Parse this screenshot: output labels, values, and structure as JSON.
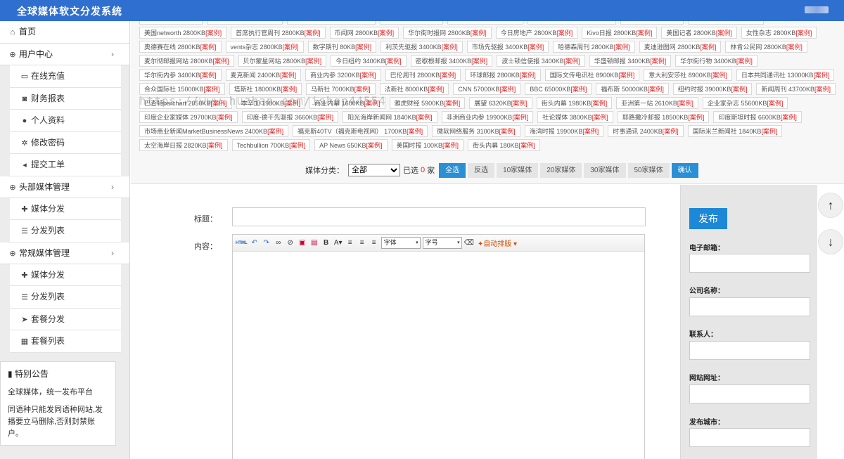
{
  "header": {
    "title": "全球媒体软文分发系统"
  },
  "sidebar": {
    "home": "首页",
    "groups": [
      {
        "label": "用户中心",
        "items": [
          "在线充值",
          "财务报表",
          "个人资料",
          "修改密码",
          "提交工单"
        ]
      },
      {
        "label": "头部媒体管理",
        "items": [
          "媒体分发",
          "分发列表"
        ]
      },
      {
        "label": "常规媒体管理",
        "items": [
          "媒体分发",
          "分发列表",
          "套餐分发",
          "套餐列表"
        ]
      }
    ],
    "notice": {
      "title": "特别公告",
      "line1": "全球媒体，统一发布平台",
      "line2": "同语种只能发同语种网站,发播要立马删除,否则封禁账户。"
    }
  },
  "watermark": "https://www.huzhan.com/ishop44554",
  "case_label": "[案例]",
  "media_rows": [
    [],
    [
      "美国networth 2800KB",
      "首席执行官周刊 2800KB",
      "币闻网 2800KB",
      "华尔街时报网 2800KB",
      "今日房地产 2800KB",
      "Kivo日报 2800KB",
      "美国记者 2800KB",
      "女性杂志 2800KB"
    ],
    [
      "奥德赛在线 2800KB",
      "vents杂志 2800KB",
      "数字期刊 80KB",
      "利茨先驱报 3400KB",
      "市场先驱报 3400KB",
      "哈德森周刊 2800KB",
      "麦迪逊图网 2800KB",
      "林肯公民网 2800KB"
    ],
    [
      "麦尔彻邮报网站 2800KB",
      "贝尔蒙星网站 2800KB",
      "今日纽约 3400KB",
      "密歇根邮报 3400KB",
      "波士顿信使报 3400KB",
      "华盛顿邮报 3400KB",
      "华尔街行物 3400KB"
    ],
    [
      "华尔街内参 3400KB",
      "麦克新闻 2400KB",
      "商业内参 3200KB",
      "巴伦周刊 2800KB",
      "环球邮报 2800KB",
      "国际文传电讯社 8900KB",
      "意大利安莎社 8900KB",
      "日本共同通讯社 13000KB"
    ],
    [
      "合众国际社 15000KB",
      "塔斯社 18000KB",
      "马新社 7000KB",
      "法新社 8000KB",
      "CNN 57000KB",
      "BBC 65000KB",
      "福布斯 50000KB",
      "纽约时报 39000KB",
      "新闻周刊 43700KB"
    ],
    [
      "巴查特barchart 2050KB",
      "本辛加 1980KB",
      "商业内幕 1600KB",
      "雅虎财经 5900KB",
      "展望 6320KB",
      "街头内幕 1980KB",
      "亚洲第一站 2610KB",
      "企业家杂志 55600KB"
    ],
    [
      "印度企业家媒体 29700KB",
      "印度-德干先驱报 3660KB",
      "阳光海岸新闻网 1840KB",
      "非洲商业内参 19900KB",
      "社论媒体 3800KB",
      "耶路撒冷邮报 18500KB",
      "印度斯坦时报 6600KB"
    ],
    [
      "市场商业新闻MarketBusinessNews 2400KB",
      "福克斯40TV（福克斯电视网） 1700KB",
      "微软网络服务 3100KB",
      "海湾时报 19900KB",
      "时事通讯 2400KB",
      "国际米兰新闻社 1840KB"
    ],
    [
      "太空海岸日报 2820KB",
      "Techbullion 700KB",
      "AP News 650KB",
      "美国时报 100KB",
      "街头内幕 180KB"
    ]
  ],
  "filter": {
    "label": "媒体分类：",
    "select_value": "全部",
    "selected_prefix": "已选",
    "selected_count": "0",
    "selected_suffix": "家",
    "buttons": [
      "全选",
      "反选",
      "10家媒体",
      "20家媒体",
      "30家媒体",
      "50家媒体",
      "确认"
    ]
  },
  "form": {
    "title_label": "标题：",
    "content_label": "内容：",
    "font_select": "字体",
    "size_select": "字号",
    "auto_format": "自动排版"
  },
  "right": {
    "publish": "发布",
    "fields": [
      "电子邮箱：",
      "公司名称：",
      "联系人：",
      "网站网址：",
      "发布城市："
    ]
  }
}
